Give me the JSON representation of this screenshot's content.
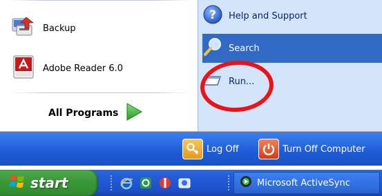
{
  "start_menu": {
    "left_items": [
      {
        "label": "Backup",
        "icon": "backup-icon"
      },
      {
        "label": "Adobe Reader 6.0",
        "icon": "adobe-reader-icon"
      }
    ],
    "all_programs": {
      "label": "All Programs",
      "icon": "green-arrow-icon"
    },
    "right_items": [
      {
        "label": "Help and Support",
        "icon": "help-icon"
      },
      {
        "label": "Search",
        "icon": "search-icon"
      },
      {
        "label": "Run...",
        "icon": "run-icon"
      }
    ],
    "footer": {
      "logoff_label": "Log Off",
      "turnoff_label": "Turn Off Computer"
    }
  },
  "taskbar": {
    "start_label": "start",
    "quick_launch": [
      "ie-icon",
      "activesync-icon",
      "media-icon",
      "outlook-icon"
    ],
    "tasks": [
      {
        "label": "Microsoft ActiveSync",
        "icon": "activesync-icon"
      }
    ]
  },
  "colors": {
    "right_panel_bg": "#d3e5fa",
    "hover_bg": "#316ac5",
    "footer_blue": "#1e5bd7",
    "start_green": "#3d9a3b",
    "annotation_red": "#e8141a"
  }
}
